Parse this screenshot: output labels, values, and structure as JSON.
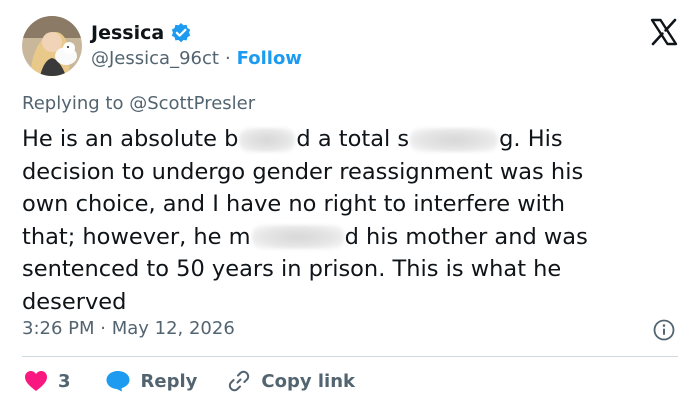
{
  "user": {
    "name": "Jessica",
    "handle": "@Jessica_96ct",
    "separator": "·",
    "follow_label": "Follow"
  },
  "reply_context": {
    "prefix": "Replying to",
    "mention": "@ScottPresler"
  },
  "tweet": {
    "line1_a": "He is an absolute b",
    "line1_b": "d a total s",
    "line1_c": "g. His",
    "line2": "decision to undergo gender reassignment was his",
    "line3": "own choice, and I have no right to interfere with",
    "line4_a": "that; however, he m",
    "line4_b": "d his mother and was",
    "line5": "sentenced to 50 years in prison. This is what he",
    "line6": "deserved"
  },
  "meta": {
    "timestamp": "3:26 PM · May 12, 2026"
  },
  "actions": {
    "like_count": "3",
    "reply_label": "Reply",
    "copy_label": "Copy link"
  },
  "colors": {
    "accent": "#1d9bf0",
    "like": "#f91880",
    "muted": "#536471",
    "text": "#0f1419"
  }
}
